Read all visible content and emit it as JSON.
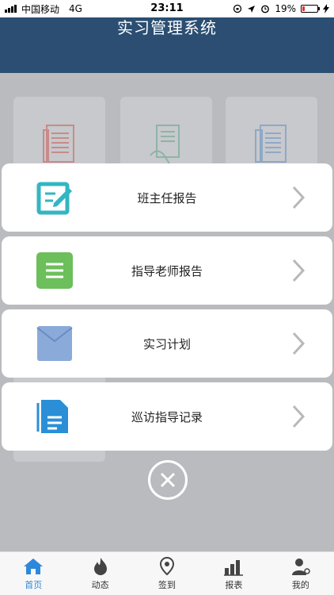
{
  "status_bar": {
    "carrier": "中国移动",
    "network": "4G",
    "time": "23:11",
    "battery": "19%",
    "battery_level": 0.19
  },
  "header": {
    "title": "实习管理系统"
  },
  "menu_items": [
    {
      "label": "班主任报告",
      "icon": "edit-report-icon",
      "color": "#33b6c2"
    },
    {
      "label": "指导老师报告",
      "icon": "list-report-icon",
      "color": "#6cbf5a"
    },
    {
      "label": "实习计划",
      "icon": "envelope-plan-icon",
      "color": "#8aaad9"
    },
    {
      "label": "巡访指导记录",
      "icon": "document-record-icon",
      "color": "#2a8fd6"
    }
  ],
  "tabs": [
    {
      "label": "首页",
      "icon": "home-icon",
      "active": true
    },
    {
      "label": "动态",
      "icon": "flame-icon",
      "active": false
    },
    {
      "label": "签到",
      "icon": "location-pin-icon",
      "active": false
    },
    {
      "label": "报表",
      "icon": "bar-chart-icon",
      "active": false
    },
    {
      "label": "我的",
      "icon": "user-icon",
      "active": false
    }
  ],
  "colors": {
    "header_bg": "#2b4e72",
    "accent": "#2e88d9"
  }
}
